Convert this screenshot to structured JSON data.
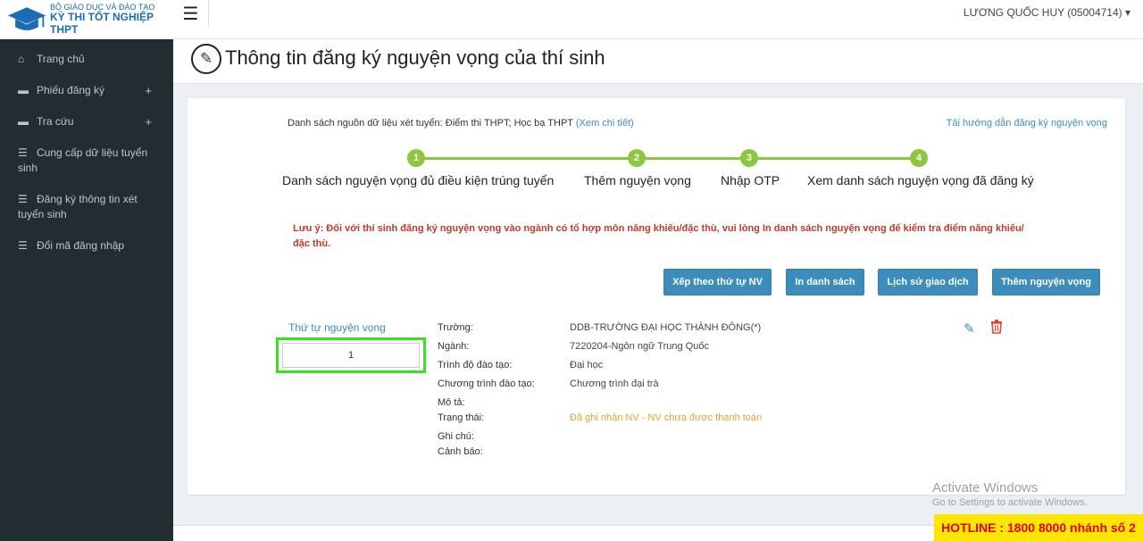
{
  "logo": {
    "line1": "BỘ GIÁO DỤC VÀ ĐÀO TẠO",
    "line2": "KỲ THI TỐT NGHIỆP THPT",
    "icon": "graduation-cap-icon"
  },
  "sidebar": {
    "items": [
      {
        "label": "Trang chủ",
        "icon": "home-icon",
        "expand": ""
      },
      {
        "label": "Phiếu đăng ký",
        "icon": "folder-icon",
        "expand": "+"
      },
      {
        "label": "Tra cứu",
        "icon": "folder-icon",
        "expand": "+"
      },
      {
        "label": "Cung cấp dữ liệu tuyển sinh",
        "icon": "list-icon",
        "expand": ""
      },
      {
        "label": "Đăng ký thông tin xét tuyển sinh",
        "icon": "list-icon",
        "expand": ""
      },
      {
        "label": "Đổi mã đăng nhập",
        "icon": "list-icon",
        "expand": ""
      }
    ]
  },
  "header": {
    "menu_icon": "☰",
    "user": "LƯƠNG QUỐC HUY (05004714)"
  },
  "page": {
    "title": "Thông tin đăng ký nguyện vọng của thí sinh"
  },
  "source": {
    "label": "Danh sách nguồn dữ liệu xét tuyển: Điểm thi THPT; Học bạ THPT",
    "link": "(Xem chi tiết)",
    "guide": "Tải hướng dẫn đăng ký nguyện vọng"
  },
  "steps": [
    {
      "num": "1",
      "label": "Danh sách nguyện vọng đủ điều kiện trúng tuyển"
    },
    {
      "num": "2",
      "label": "Thêm nguyện vọng"
    },
    {
      "num": "3",
      "label": "Nhập OTP"
    },
    {
      "num": "4",
      "label": "Xem danh sách nguyện vọng đã đăng ký"
    }
  ],
  "note": "Lưu ý: Đối với thí sinh đăng ký nguyện vọng vào ngành có tổ hợp môn năng khiếu/đặc thù, vui lòng In danh sách nguyện vọng để kiểm tra điểm năng khiếu/đặc thù.",
  "buttons": {
    "sort": "Xếp theo thứ tự NV",
    "print": "In danh sách",
    "history": "Lịch sử giao dịch",
    "add": "Thêm nguyện vọng"
  },
  "record": {
    "order_label": "Thứ tự nguyện vọng",
    "order_value": "1",
    "fields": [
      {
        "label": "Trường:",
        "value": "DDB-TRƯỜNG ĐẠI HỌC THÀNH ĐÔNG(*)"
      },
      {
        "label": "Ngành:",
        "value": "7220204-Ngôn ngữ Trung Quốc"
      },
      {
        "label": "Trình độ đào tạo:",
        "value": "Đại học"
      },
      {
        "label": "Chương trình đào tạo:",
        "value": "Chương trình đại trà"
      },
      {
        "label": "Mô tả:",
        "value": ""
      },
      {
        "label": "Trạng thái:",
        "value": "Đã ghi nhận NV - NV chưa được thanh toán"
      },
      {
        "label": "Ghi chú:",
        "value": ""
      },
      {
        "label": "Cảnh báo:",
        "value": ""
      }
    ]
  },
  "overlay": {
    "activate_title": "Activate Windows",
    "activate_sub": "Go to Settings to activate Windows.",
    "hotline": "HOTLINE : 1800 8000 nhánh số 2"
  },
  "colors": {
    "accent": "#3c8dbc",
    "step": "#8dc63f",
    "warning": "#c0392b",
    "status": "#f0a030",
    "sidebar": "#222d32"
  }
}
